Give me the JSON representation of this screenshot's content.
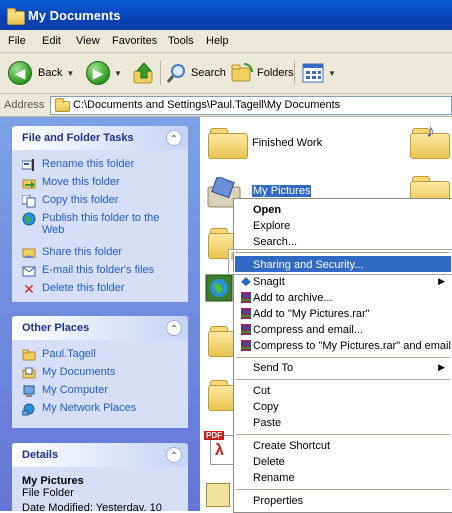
{
  "window": {
    "title": "My Documents"
  },
  "menu": [
    "File",
    "Edit",
    "View",
    "Favorites",
    "Tools",
    "Help"
  ],
  "toolbar": {
    "back": "Back",
    "search": "Search",
    "folders": "Folders"
  },
  "address": {
    "label": "Address",
    "path": "C:\\Documents and Settings\\Paul.Tagell\\My Documents"
  },
  "tasks": {
    "title": "File and Folder Tasks",
    "items": [
      "Rename this folder",
      "Move this folder",
      "Copy this folder",
      "Publish this folder to the Web",
      "Share this folder",
      "E-mail this folder's files",
      "Delete this folder"
    ]
  },
  "places": {
    "title": "Other Places",
    "items": [
      "Paul.Tagell",
      "My Documents",
      "My Computer",
      "My Network Places"
    ]
  },
  "details": {
    "title": "Details",
    "name": "My Pictures",
    "type": "File Folder",
    "modified": "Date Modified: Yesterday, 10"
  },
  "files": {
    "finished_work": "Finished Work",
    "my_pictures": "My Pictures"
  },
  "context_menu": {
    "open": "Open",
    "explore": "Explore",
    "search": "Search...",
    "sharing": "Sharing and Security...",
    "snagit": "SnagIt",
    "add_archive": "Add to archive...",
    "add_rar": "Add to \"My Pictures.rar\"",
    "compress_email": "Compress and email...",
    "compress_rar_email": "Compress to \"My Pictures.rar\" and email",
    "send_to": "Send To",
    "cut": "Cut",
    "copy": "Copy",
    "paste": "Paste",
    "create_shortcut": "Create Shortcut",
    "delete": "Delete",
    "rename": "Rename",
    "properties": "Properties"
  },
  "icon_labels": {
    "pdf": "PDF"
  },
  "colors": {
    "titlebar": "#0842b6",
    "selection": "#316ac5",
    "link": "#215dc6",
    "panel_header": "#1e3287"
  }
}
